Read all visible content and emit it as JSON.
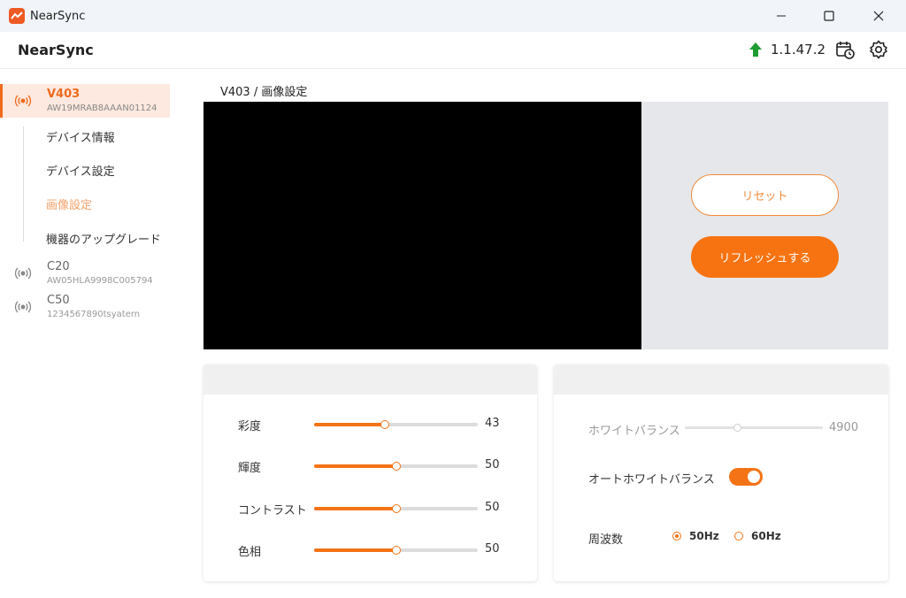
{
  "window": {
    "title": "NearSync",
    "minimize_icon": "minimize-icon",
    "maximize_icon": "maximize-icon",
    "close_icon": "close-icon"
  },
  "header": {
    "brand": "NearSync",
    "version": "1.1.47.2",
    "upgrade_icon": "upgrade-arrow-icon",
    "schedule_icon": "calendar-clock-icon",
    "settings_icon": "gear-icon"
  },
  "sidebar": {
    "devices": [
      {
        "name": "V403",
        "serial": "AW19MRAB8AAAN01124",
        "active": true,
        "submenu": [
          {
            "label": "デバイス情報",
            "active": false
          },
          {
            "label": "デバイス設定",
            "active": false
          },
          {
            "label": "画像設定",
            "active": true
          },
          {
            "label": "機器のアップグレード",
            "active": false
          }
        ]
      },
      {
        "name": "C20",
        "serial": "AW05HLA9998C005794",
        "active": false
      },
      {
        "name": "C50",
        "serial": "1234567890tsyatern",
        "active": false
      }
    ]
  },
  "main": {
    "breadcrumb": "V403 / 画像設定",
    "reset_label": "リセット",
    "refresh_label": "リフレッシュする",
    "image": {
      "sliders": [
        {
          "label": "彩度",
          "value": 43,
          "level": 0.43
        },
        {
          "label": "輝度",
          "value": 50,
          "level": 0.5
        },
        {
          "label": "コントラスト",
          "value": 50,
          "level": 0.5
        },
        {
          "label": "色相",
          "value": 50,
          "level": 0.5
        }
      ]
    },
    "white": {
      "wb_label": "ホワイトバランス",
      "wb_value": "4900",
      "wb_level": 0.38,
      "awb_label": "オートホワイトバランス",
      "awb_on": true,
      "freq_label": "周波数",
      "freq_options": [
        "50Hz",
        "60Hz"
      ],
      "freq_selected": "50Hz"
    }
  },
  "colors": {
    "accent": "#f47316",
    "accent_light": "#fde9df",
    "preview_bg": "#000000"
  }
}
